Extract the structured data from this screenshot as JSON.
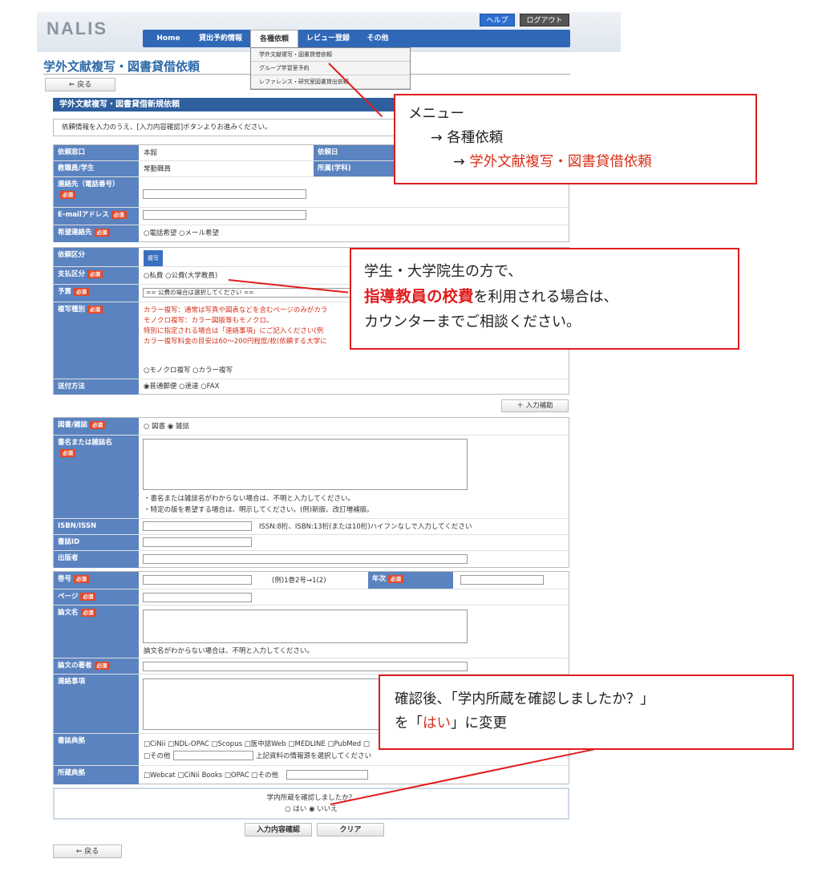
{
  "header": {
    "logo": "NALIS",
    "help": "ヘルプ",
    "logout": "ログアウト"
  },
  "nav": {
    "items": [
      "Home",
      "貸出予約情報",
      "各種依頼",
      "レビュー登録",
      "その他"
    ],
    "dropdown": [
      "学外文献複写・図書貸借依頼",
      "グループ学習室予約",
      "レファレンス・研究室図書貸出依頼"
    ]
  },
  "page": {
    "title": "学外文献複写・図書貸借依頼",
    "back": "⇐ 戻る",
    "form_head": "学外文献複写・図書貸借新規依頼",
    "notice": "依頼情報を入力のうえ、[入力内容確認]ボタンよりお進みください。"
  },
  "req": "必須",
  "s1": {
    "window_label": "依頼窓口",
    "window_val": "本館",
    "date_label": "依頼日",
    "staff_label": "教職員/学生",
    "staff_val": "常勤職員",
    "dept_label": "所属(学科)",
    "tel_label": "連絡先（電話番号）",
    "email_label": "E-mailアドレス",
    "contact_label": "希望連絡先",
    "contact_opts": "○電話希望 ○メール希望"
  },
  "s2": {
    "type_label": "依頼区分",
    "type_val": "複写",
    "pay_label": "支払区分",
    "pay_opts": "○私費 ○公費(大学教員)",
    "budget_label": "予算",
    "budget_val": "== 公費の場合は選択してください ==",
    "copy_label": "複写種別",
    "copy_note1": "カラー複写：通常は写真や図表などを含むページのみがカラ",
    "copy_note2": "モノクロ複写：カラー図版等もモノクロ。",
    "copy_note3": "特別に指定される場合は「連絡事項」にご記入ください(例",
    "copy_note4": "カラー複写料金の目安は60～200円程度/枚(依頼する大学に",
    "copy_opts": "○モノクロ複写 ○カラー複写",
    "send_label": "送付方法",
    "send_opts": "◉普通郵便 ○速達 ○FAX"
  },
  "assist": "＋ 入力補助",
  "s3": {
    "bookmag_label": "図書/雑誌",
    "bookmag_opts": "○ 図書 ◉ 雑誌",
    "title_label": "書名または雑誌名",
    "title_note1": "・書名または雑誌名がわからない場合は、不明と入力してください。",
    "title_note2": "・特定の版を希望する場合は、明示してください。(例)新版、改訂増補版。",
    "isbn_label": "ISBN/ISSN",
    "isbn_note": "ISSN:8桁、ISBN:13桁(または10桁)ハイフンなしで入力してください",
    "bibid_label": "書誌ID",
    "publisher_label": "出版者"
  },
  "s4": {
    "vol_label": "巻号",
    "vol_note": "(例)1巻2号→1(2)",
    "year_label": "年次",
    "page_label": "ページ",
    "article_label": "論文名",
    "article_note": "論文名がわからない場合は、不明と入力してください。",
    "author_label": "論文の著者",
    "remarks_label": "連絡事項",
    "biblio_label": "書誌典拠",
    "biblio_opts1": "□CiNii □NDL-OPAC □Scopus □医中誌Web □MEDLINE □PubMed □",
    "biblio_opts2a": "□その他",
    "biblio_opts2b": "上記資料の情報源を選択してください",
    "holding_label": "所蔵典拠",
    "holding_opts": "□Webcat □CiNii Books □OPAC □その他"
  },
  "confirm": {
    "question": "学内所蔵を確認しましたか？",
    "opts": "○ はい ◉ いいえ"
  },
  "actions": {
    "confirm": "入力内容確認",
    "clear": "クリア",
    "back": "⇐ 戻る"
  },
  "callouts": {
    "c1_l1": "メニュー",
    "c1_l2": "→ 各種依頼",
    "c1_l3a": "→ ",
    "c1_l3b": "学外文献複写・図書貸借依頼",
    "c2_l1": "学生・大学院生の方で、",
    "c2_l2a": "指導教員の校費",
    "c2_l2b": "を利用される場合は、",
    "c2_l3": "カウンターまでご相談ください。",
    "c3_l1": "確認後、「学内所蔵を確認しましたか？」",
    "c3_l2a": "を「",
    "c3_l2b": "はい",
    "c3_l2c": "」に変更"
  },
  "colors": {
    "accent": "#2f5f9e",
    "label_bg": "#5b83c0",
    "callout": "#e01d1d"
  }
}
